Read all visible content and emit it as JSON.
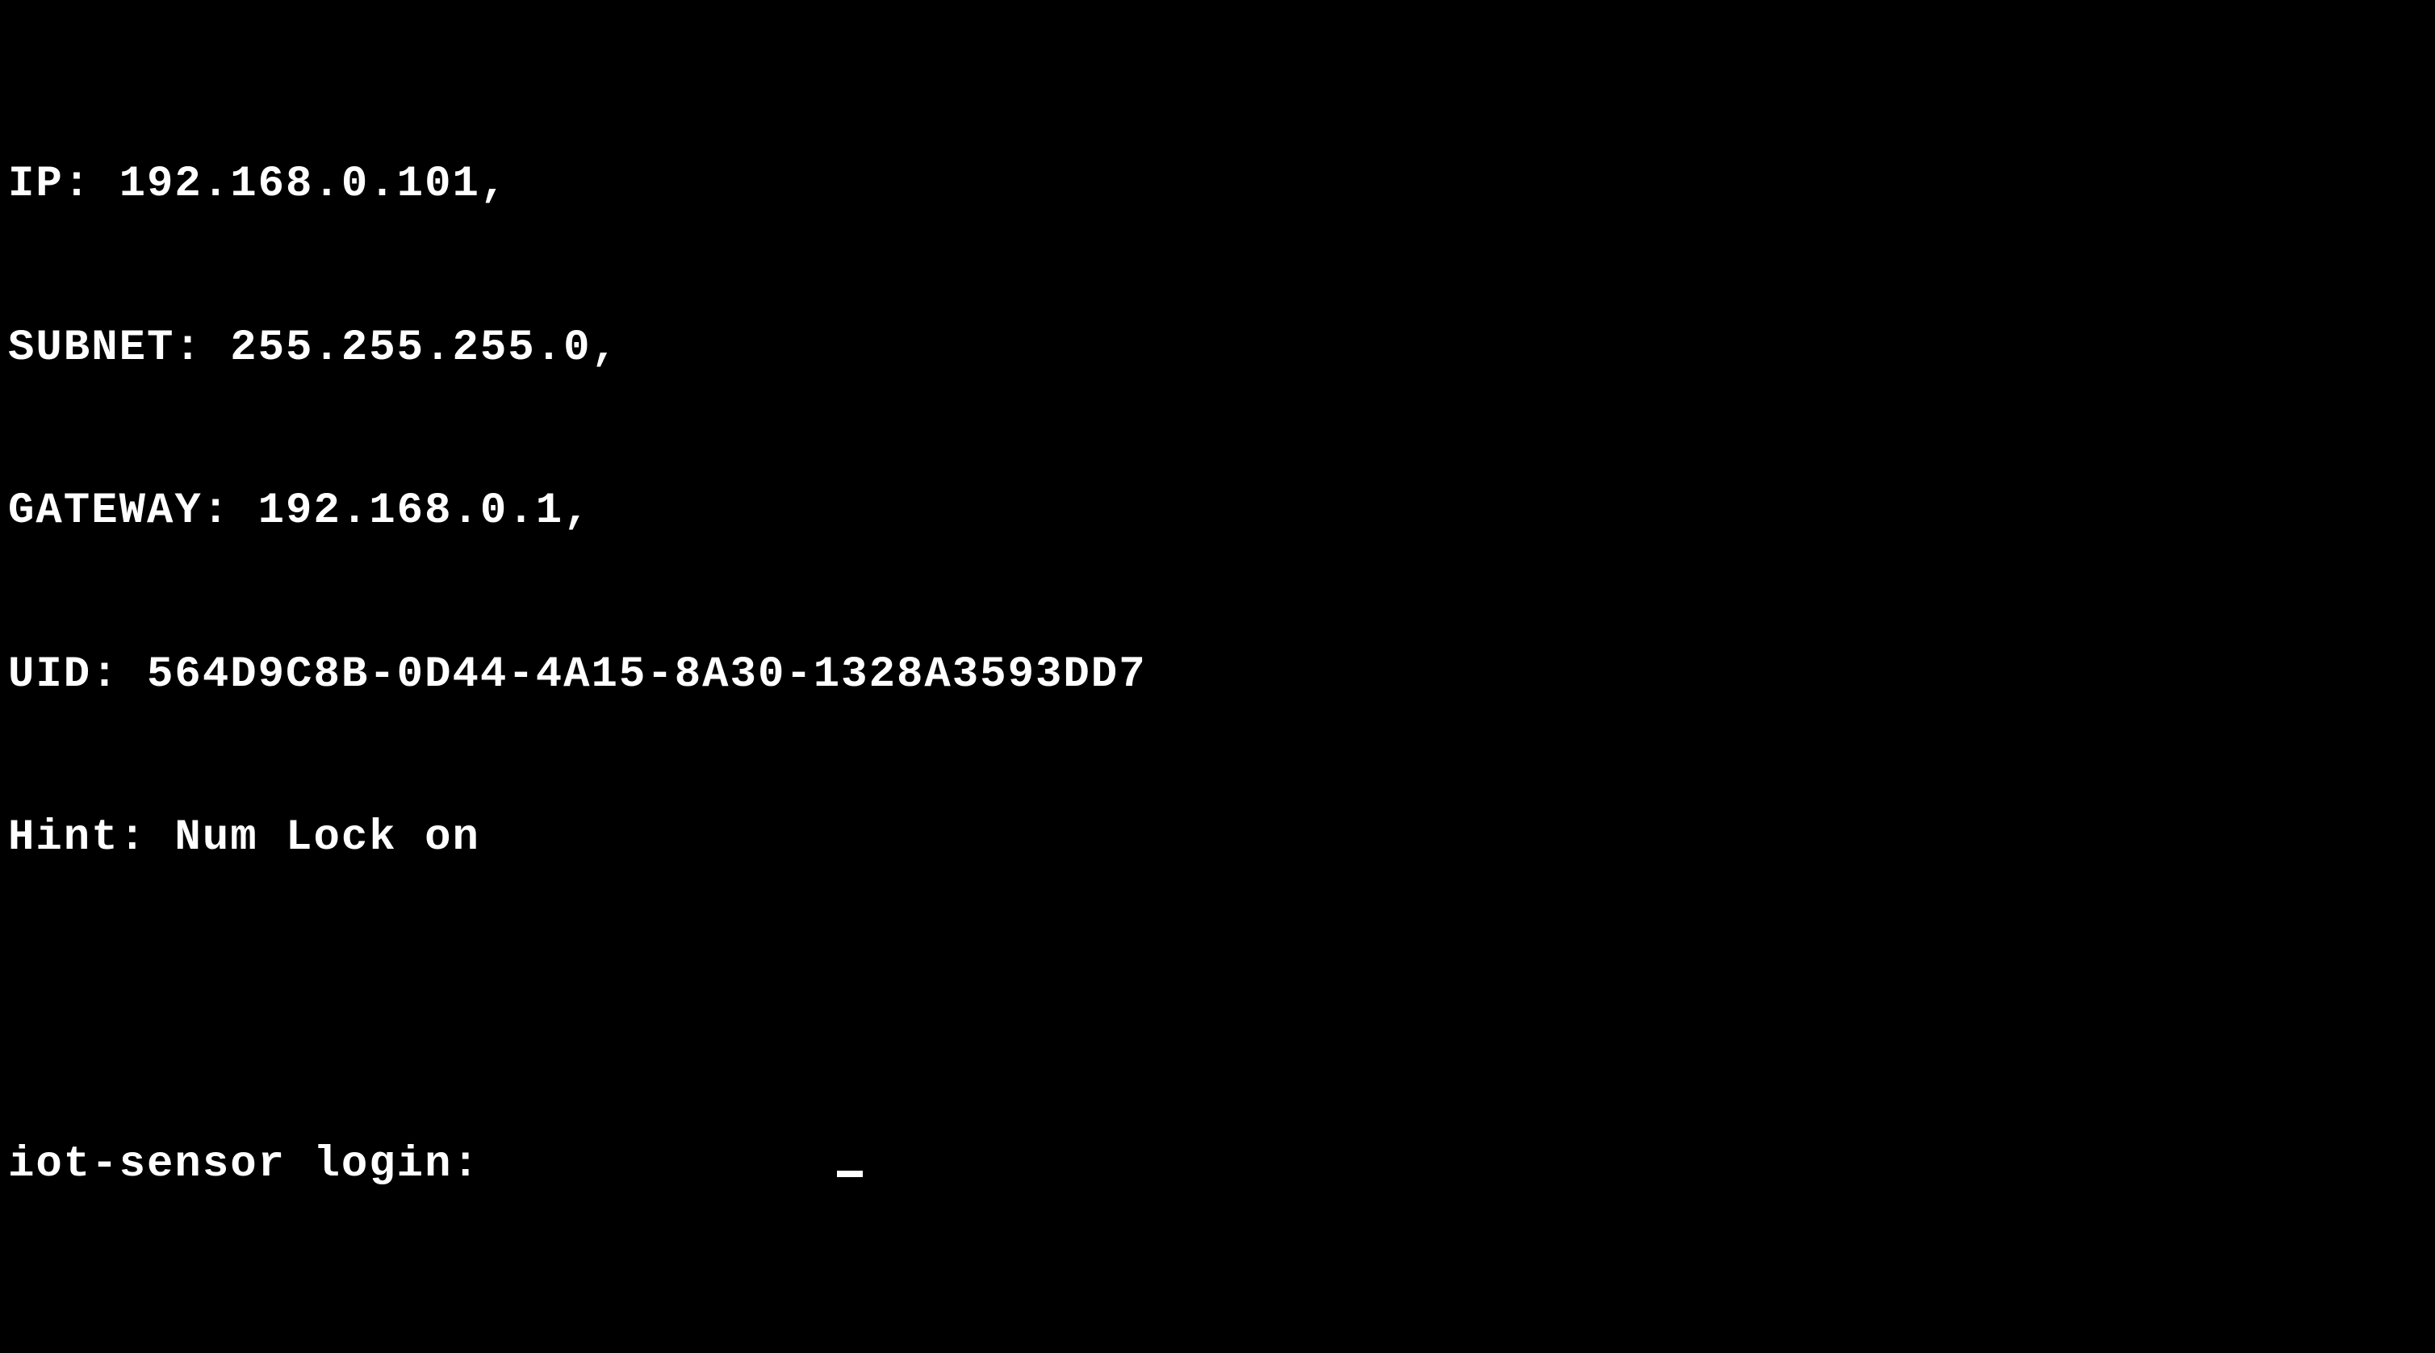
{
  "terminal": {
    "ip_line": "IP: 192.168.0.101,",
    "subnet_line": "SUBNET: 255.255.255.0,",
    "gateway_line": "GATEWAY: 192.168.0.1,",
    "uid_line": "UID: 564D9C8B-0D44-4A15-8A30-1328A3593DD7",
    "hint_line": "Hint: Num Lock on",
    "login_prompt": "iot-sensor login: ",
    "login_value": ""
  }
}
